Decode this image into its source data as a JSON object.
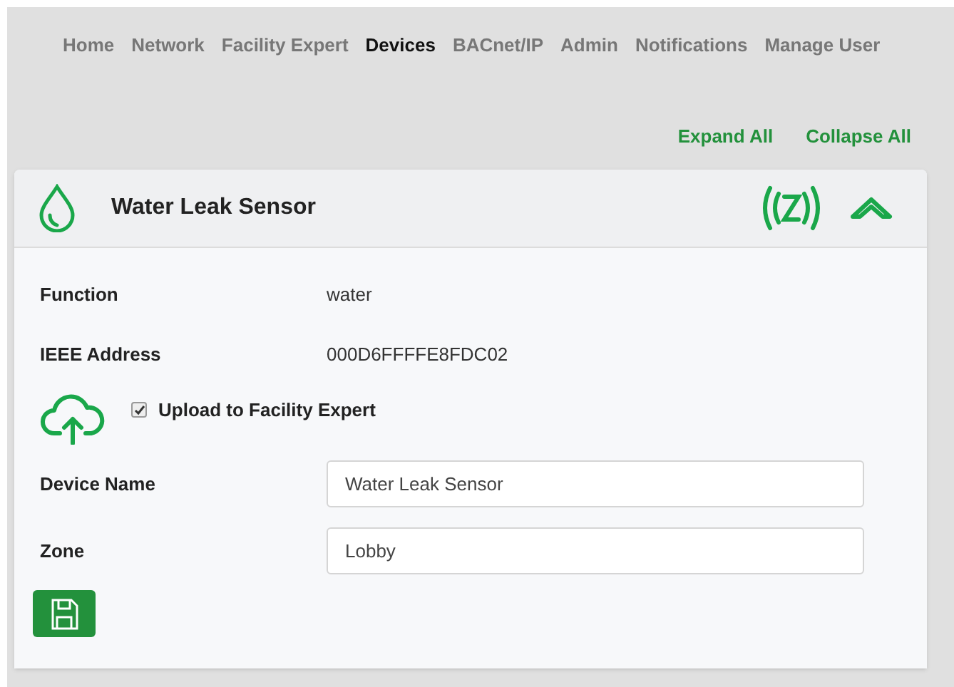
{
  "nav": [
    {
      "label": "Home",
      "selected": false
    },
    {
      "label": "Network",
      "selected": false
    },
    {
      "label": "Facility Expert",
      "selected": false
    },
    {
      "label": "Devices",
      "selected": true
    },
    {
      "label": "BACnet/IP",
      "selected": false
    },
    {
      "label": "Admin",
      "selected": false
    },
    {
      "label": "Notifications",
      "selected": false
    },
    {
      "label": "Manage User",
      "selected": false
    }
  ],
  "actions": [
    "Expand All",
    "Collapse All"
  ],
  "card": {
    "title": "Water Leak Sensor",
    "expanded": true,
    "info": [
      {
        "label": "Function",
        "value": "water"
      },
      {
        "label": "IEEE Address",
        "value": "000D6FFFFE8FDC02"
      }
    ],
    "upload": {
      "label": "Upload to Facility Expert",
      "checked": true
    },
    "fields": [
      {
        "label": "Device Name",
        "value": "Water Leak Sensor"
      },
      {
        "label": "Zone",
        "value": "Lobby"
      }
    ]
  }
}
